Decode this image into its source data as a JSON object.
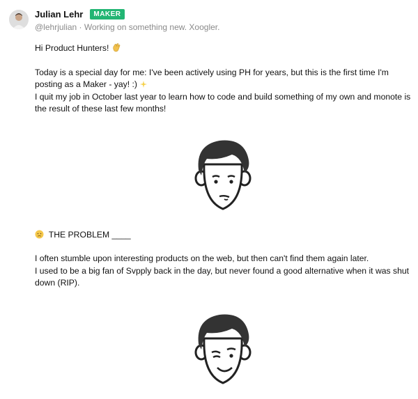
{
  "author": {
    "name": "Julian Lehr",
    "badge": "MAKER",
    "handle": "@lehrjulian",
    "separator": " · ",
    "headline": "Working on something new. Xoogler."
  },
  "post": {
    "greeting": "Hi Product Hunters!",
    "intro_line1": "Today is a special day for me: I've been actively using PH for years, but this is the first time I'm posting as a Maker - yay! :)",
    "intro_line2": "I quit my job in October last year to learn how to code and build something of my own and monote is the result of these last few months!",
    "problem_heading": "THE PROBLEM ____",
    "problem_line1": "I often stumble upon interesting products on the web, but then can't find them again later.",
    "problem_line2": "I used to be a big fan of Svpply back in the day, but never found a good alternative when it was shut down (RIP)."
  },
  "icons": [
    "waving-hand-icon",
    "sparkles-icon",
    "sad-face-icon"
  ]
}
